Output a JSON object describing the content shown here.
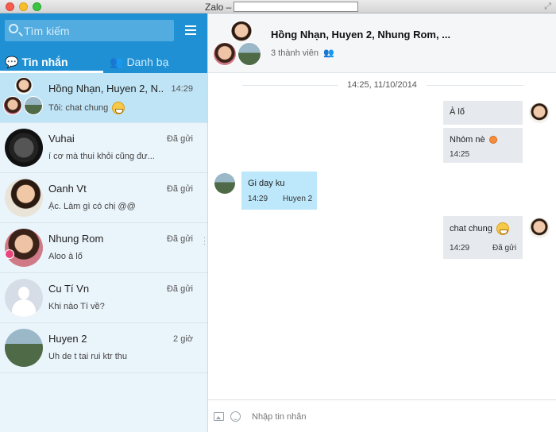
{
  "window": {
    "title": "Zalo –"
  },
  "sidebar": {
    "search_placeholder": "Tìm kiếm",
    "tabs": [
      {
        "label": "Tin nhắn",
        "active": true
      },
      {
        "label": "Danh bạ",
        "active": false
      }
    ],
    "conversations": [
      {
        "name": "Hồng Nhạn, Huyen 2, N...",
        "time": "14:29",
        "preview": "Tôi: chat chung",
        "avatar": "group",
        "selected": true,
        "emoji": "grin"
      },
      {
        "name": "Vuhai",
        "time": "Đã gửi",
        "preview": "í cơ mà thui khỏi cũng đư...",
        "avatar": "watch-photo"
      },
      {
        "name": "Oanh Vt",
        "time": "Đã gửi",
        "preview": "Ặc. Làm gì có chị @@",
        "avatar": "woman-photo"
      },
      {
        "name": "Nhung Rom",
        "time": "Đã gửi",
        "preview": "Aloo à lố",
        "avatar": "woman-photo-heart"
      },
      {
        "name": "Cu Tí Vn",
        "time": "Đã gửi",
        "preview": "Khi nào Tí về?",
        "avatar": "default-avatar"
      },
      {
        "name": "Huyen 2",
        "time": "2 giờ",
        "preview": "Uh de t tai rui ktr thu",
        "avatar": "park-photo"
      }
    ]
  },
  "chat": {
    "title": "Hồng Nhạn, Huyen 2, Nhung Rom, ...",
    "members": "3 thành viên",
    "date_divider": "14:25, 11/10/2014",
    "messages": [
      {
        "side": "me",
        "text": "À lố"
      },
      {
        "side": "me",
        "text": "Nhóm nè",
        "time": "14:25",
        "emoji": "tongue"
      },
      {
        "side": "them",
        "text": "Gi day ku",
        "time": "14:29",
        "sender": "Huyen 2"
      },
      {
        "side": "me",
        "text": "chat chung",
        "time": "14:29",
        "status": "Đã gửi",
        "emoji": "grin"
      }
    ],
    "composer_placeholder": "Nhập tin nhắn"
  },
  "colors": {
    "accent": "#1f90d4",
    "selected_row": "#bfe4f6",
    "incoming_bubble": "#bde8fb",
    "outgoing_bubble": "#e6eaee"
  }
}
